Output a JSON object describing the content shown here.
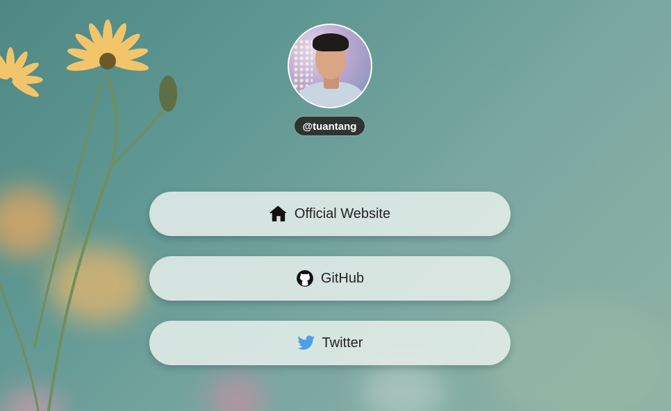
{
  "profile": {
    "username": "@tuantang"
  },
  "links": [
    {
      "label": "Official Website",
      "icon": "home-icon"
    },
    {
      "label": "GitHub",
      "icon": "github-icon"
    },
    {
      "label": "Twitter",
      "icon": "twitter-icon"
    }
  ],
  "colors": {
    "username_badge_bg": "#2e3432",
    "button_bg": "#e8f0ec",
    "twitter_blue": "#4a9fe8",
    "text": "#222222"
  }
}
